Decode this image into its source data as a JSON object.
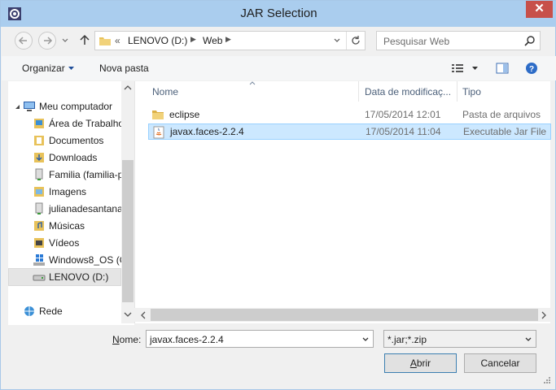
{
  "window": {
    "title": "JAR Selection",
    "close_glyph": "✕"
  },
  "address": {
    "overflow": "«",
    "crumbs": [
      "LENOVO (D:)",
      "Web"
    ],
    "search_placeholder": "Pesquisar Web"
  },
  "toolbar": {
    "organize": "Organizar",
    "new_folder": "Nova pasta"
  },
  "nav": {
    "computer": "Meu computador",
    "items": [
      "Área de Trabalho",
      "Documentos",
      "Downloads",
      "Familia (familia-p",
      "Imagens",
      "julianadesantana",
      "Músicas",
      "Vídeos",
      "Windows8_OS (C",
      "LENOVO (D:)"
    ],
    "network": "Rede"
  },
  "columns": {
    "name": "Nome",
    "date": "Data de modificaç...",
    "type": "Tipo"
  },
  "files": [
    {
      "name": "eclipse",
      "date": "17/05/2014 12:01",
      "type": "Pasta de arquivos"
    },
    {
      "name": "javax.faces-2.2.4",
      "date": "17/05/2014 11:04",
      "type": "Executable Jar File"
    }
  ],
  "bottom": {
    "name_label_underline": "N",
    "name_label_rest": "ome:",
    "filename": "javax.faces-2.2.4",
    "filter": "*.jar;*.zip",
    "open_underline": "A",
    "open_rest": "brir",
    "cancel": "Cancelar"
  },
  "colors": {
    "titlebar": "#aacdee",
    "close": "#c7504a",
    "selection": "#cce8ff",
    "selection_border": "#99d1ff",
    "folder": "#e8c25a"
  }
}
